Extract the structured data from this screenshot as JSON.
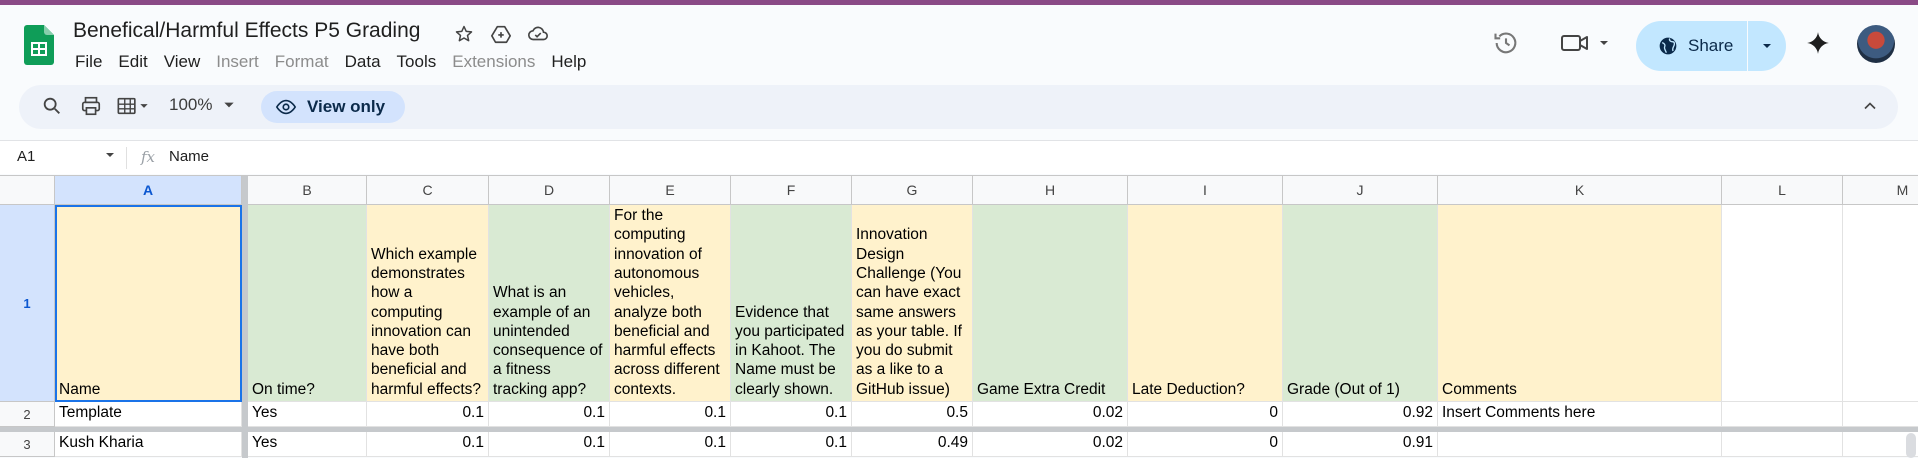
{
  "app": {
    "doc_title": "Benefical/Harmful Effects P5 Grading",
    "accent_color": "#8a4a86",
    "logo_icon": "google-sheets-logo"
  },
  "menu": [
    "File",
    "Edit",
    "View",
    "Insert",
    "Format",
    "Data",
    "Tools",
    "Extensions",
    "Help"
  ],
  "menu_disabled": [
    "Insert",
    "Format",
    "Extensions"
  ],
  "header_actions": {
    "share_label": "Share"
  },
  "toolbar": {
    "zoom": "100%",
    "view_only_label": "View only"
  },
  "formula_bar": {
    "name_box": "A1",
    "fx": "fx",
    "formula": "Name"
  },
  "grid": {
    "columns": [
      "A",
      "B",
      "C",
      "D",
      "E",
      "F",
      "G",
      "H",
      "I",
      "J",
      "K",
      "L",
      "M"
    ],
    "row_numbers": [
      "1",
      "2",
      "3"
    ],
    "header_row": [
      "Name",
      "On time?",
      "Which example demonstrates how a computing innovation can have both beneficial and harmful effects?",
      "What is an example of an unintended consequence of a fitness tracking app?",
      "For the computing innovation of autonomous vehicles, analyze both beneficial and harmful effects across different contexts.",
      "Evidence that you participated in Kahoot. The Name must be clearly shown.",
      "Innovation Design Challenge (You can have exact same answers as your table. If you do submit as a like to a GitHub issue)",
      "Game Extra Credit",
      "Late Deduction?",
      "Grade (Out of 1)",
      "Comments"
    ],
    "rows": [
      [
        "Template",
        "Yes",
        "0.1",
        "0.1",
        "0.1",
        "0.1",
        "0.5",
        "0.02",
        "0",
        "0.92",
        "Insert Comments here"
      ],
      [
        "Kush Kharia",
        "Yes",
        "0.1",
        "0.1",
        "0.1",
        "0.1",
        "0.49",
        "0.02",
        "0",
        "0.91",
        ""
      ]
    ],
    "header_colors": [
      "yellow",
      "green",
      "yellow",
      "green",
      "yellow",
      "green",
      "yellow",
      "green",
      "yellow",
      "green",
      "yellow"
    ]
  }
}
